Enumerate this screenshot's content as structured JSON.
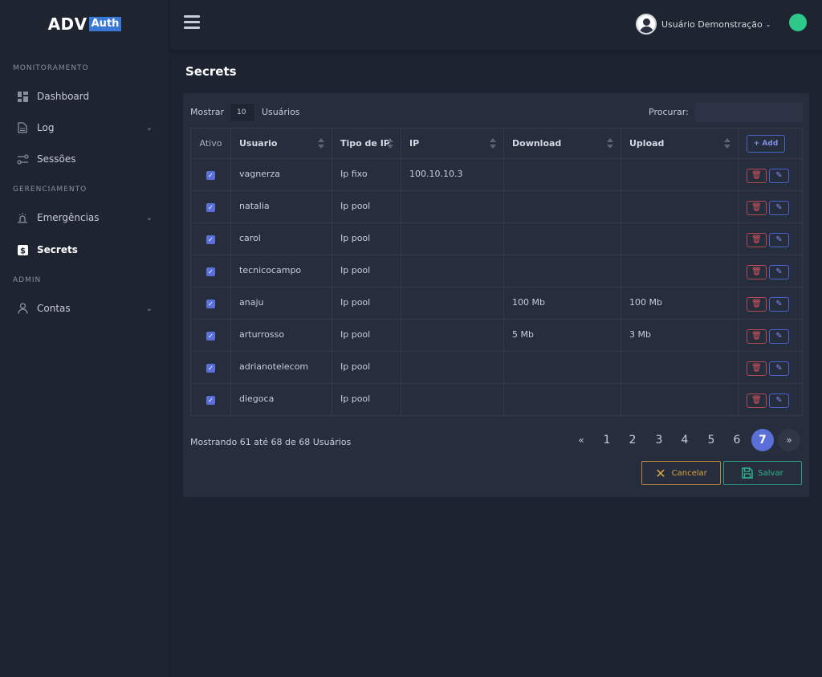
{
  "logo": {
    "main": "ADV",
    "badge": "Auth"
  },
  "sidebar": {
    "sections": [
      "MONITORAMENTO",
      "GERENCIAMENTO",
      "ADMIN"
    ],
    "items": [
      {
        "label": "Dashboard",
        "icon": "dashboard-icon"
      },
      {
        "label": "Log",
        "icon": "document-icon"
      },
      {
        "label": "Sessões",
        "icon": "sessions-icon"
      },
      {
        "label": "Emergências",
        "icon": "emergency-icon"
      },
      {
        "label": "Secrets",
        "icon": "dollar-icon"
      },
      {
        "label": "Contas",
        "icon": "user-icon"
      }
    ]
  },
  "header": {
    "user_name": "Usuário Demonstração",
    "status_color": "#2ec98a"
  },
  "page": {
    "title": "Secrets"
  },
  "controls": {
    "show_label": "Mostrar",
    "show_value": "10",
    "show_suffix": "Usuários",
    "search_label": "Procurar:",
    "search_value": ""
  },
  "table": {
    "columns": [
      "Ativo",
      "Usuario",
      "Tipo de IP",
      "IP",
      "Download",
      "Upload"
    ],
    "add_label": "+ Add",
    "rows": [
      {
        "usuario": "vagnerza",
        "tipo": "Ip fixo",
        "ip": "100.10.10.3",
        "download": "",
        "upload": ""
      },
      {
        "usuario": "natalia",
        "tipo": "Ip pool",
        "ip": "",
        "download": "",
        "upload": ""
      },
      {
        "usuario": "carol",
        "tipo": "Ip pool",
        "ip": "",
        "download": "",
        "upload": ""
      },
      {
        "usuario": "tecnicocampo",
        "tipo": "Ip pool",
        "ip": "",
        "download": "",
        "upload": ""
      },
      {
        "usuario": "anaju",
        "tipo": "Ip pool",
        "ip": "",
        "download": "100 Mb",
        "upload": "100 Mb"
      },
      {
        "usuario": "arturrosso",
        "tipo": "Ip pool",
        "ip": "",
        "download": "5 Mb",
        "upload": "3 Mb"
      },
      {
        "usuario": "adrianotelecom",
        "tipo": "Ip pool",
        "ip": "",
        "download": "",
        "upload": ""
      },
      {
        "usuario": "diegoca",
        "tipo": "Ip pool",
        "ip": "",
        "download": "",
        "upload": ""
      }
    ]
  },
  "footer": {
    "info": "Mostrando 61 até 68 de 68 Usuários",
    "pager": [
      "«",
      "1",
      "2",
      "3",
      "4",
      "5",
      "6",
      "7",
      "»"
    ],
    "current_page": "7",
    "cancel_label": "Cancelar",
    "save_label": "Salvar"
  },
  "colors": {
    "accent": "#5b6fd8",
    "danger": "#d9545f",
    "warning": "#d9a53f",
    "success": "#2fb88f"
  }
}
